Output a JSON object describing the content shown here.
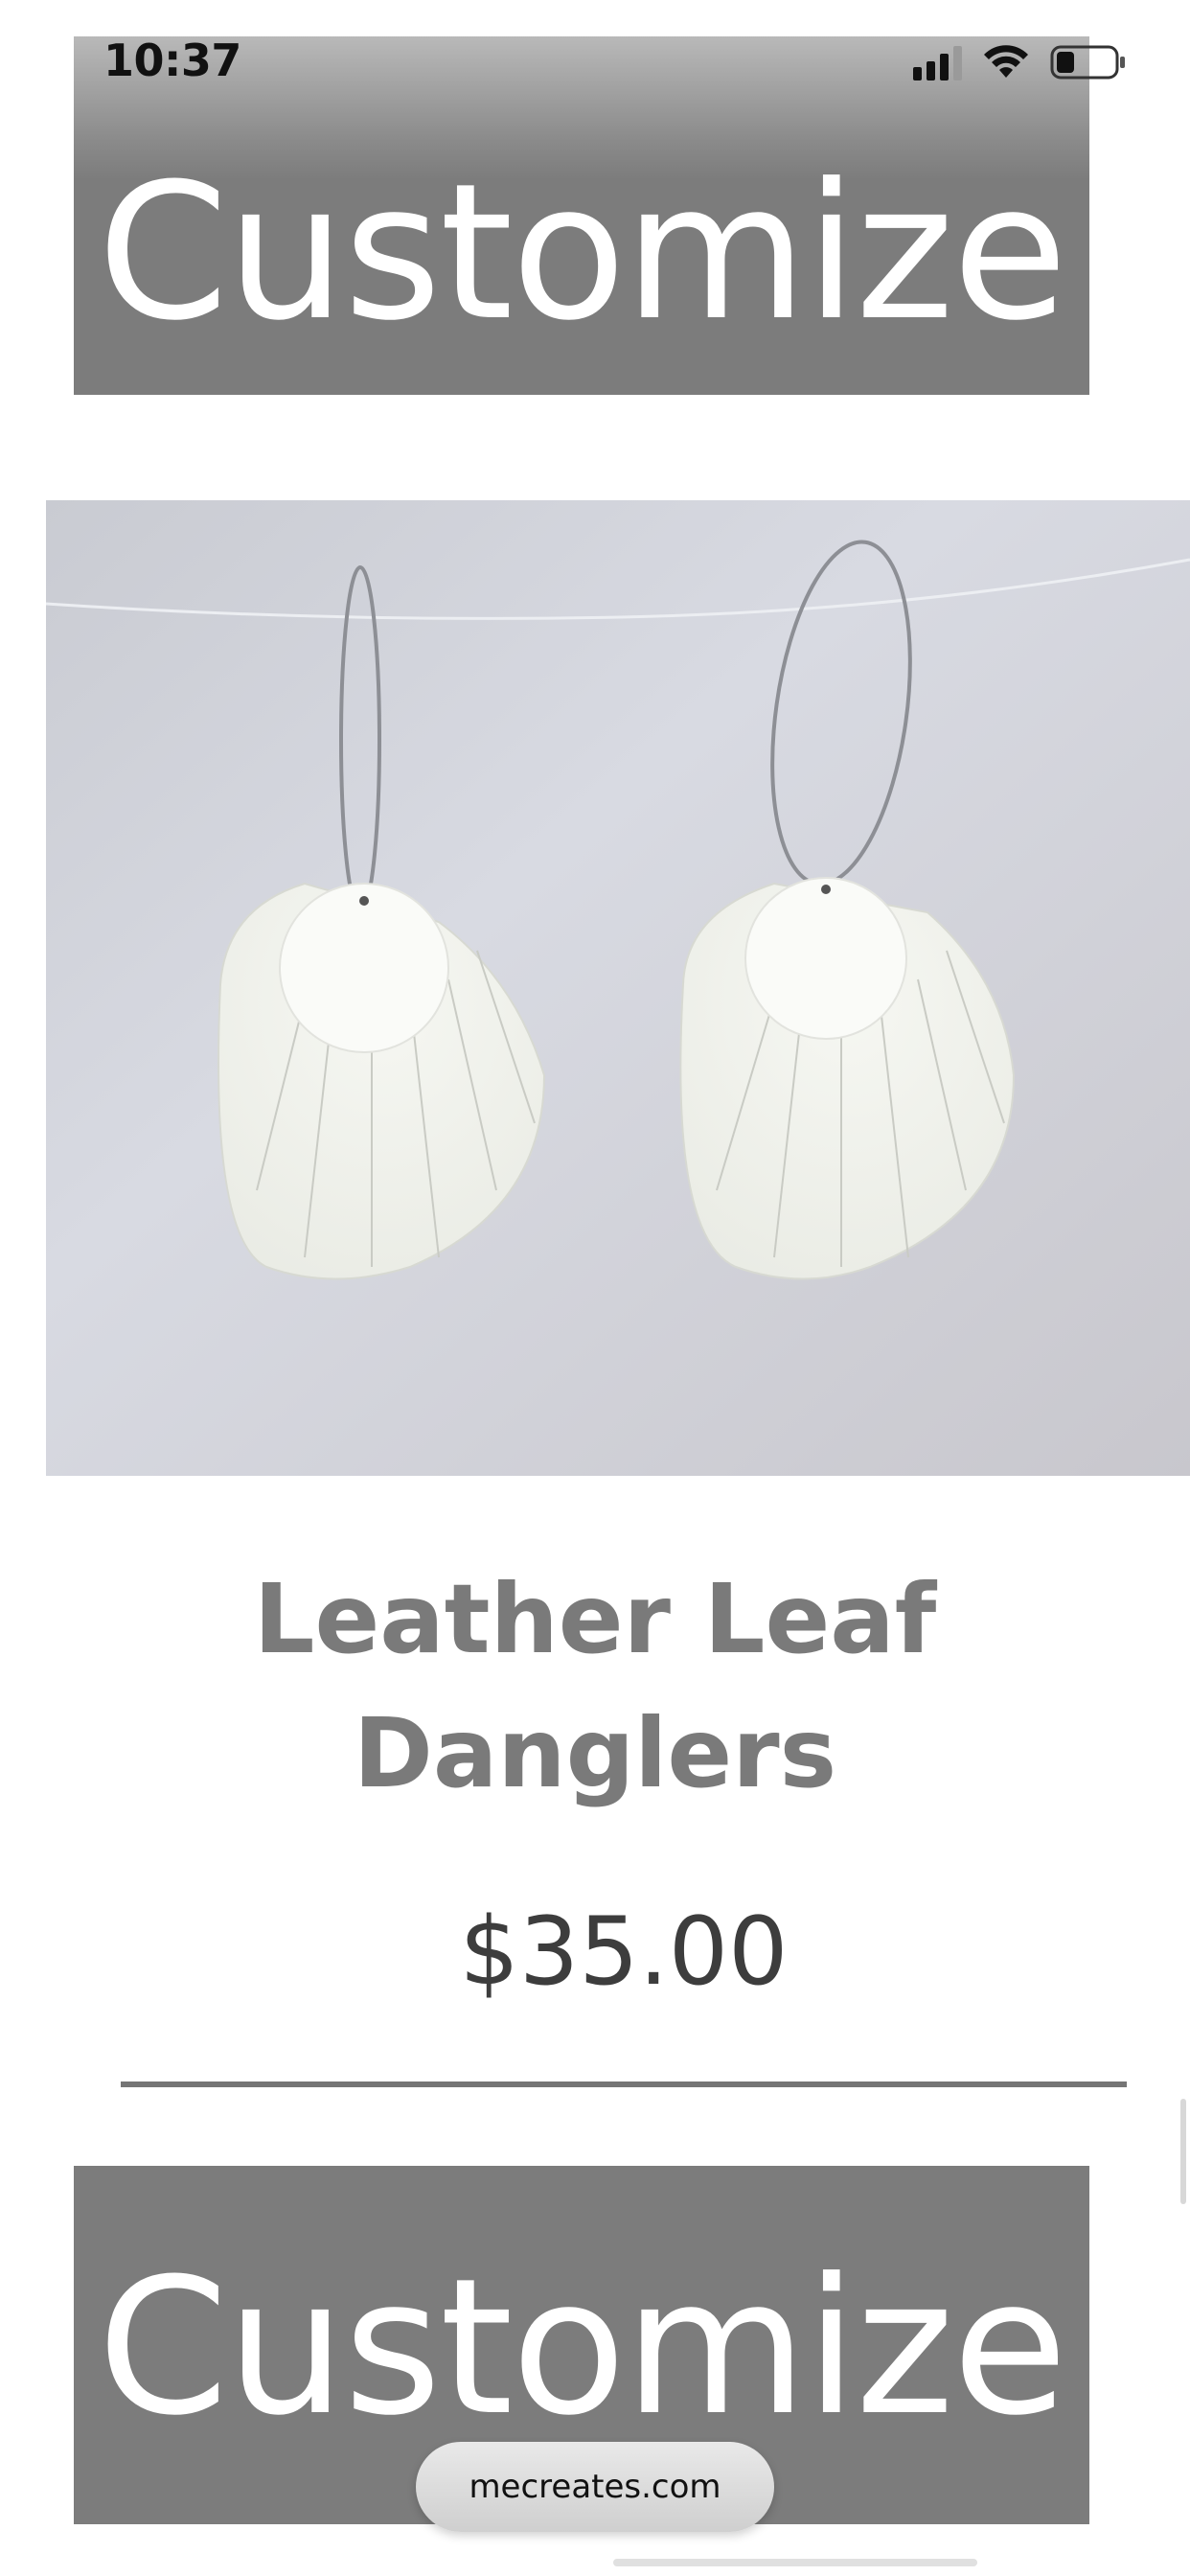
{
  "status_bar": {
    "time": "10:37",
    "icons": [
      "cellular-signal-icon",
      "wifi-icon",
      "battery-icon"
    ]
  },
  "banners": {
    "top_label": "Customize",
    "bottom_label": "Customize",
    "color": "#7c7c7c"
  },
  "product": {
    "image_icon": "leather-leaf-dangler-earrings-photo",
    "title_line1": "Leather Leaf",
    "title_line2": "Danglers",
    "price": "$35.00"
  },
  "browser": {
    "url": "mecreates.com"
  },
  "colors": {
    "banner": "#7c7c7c",
    "title": "#7a7a7a",
    "price": "#3d3d3d",
    "divider": "#757575"
  }
}
